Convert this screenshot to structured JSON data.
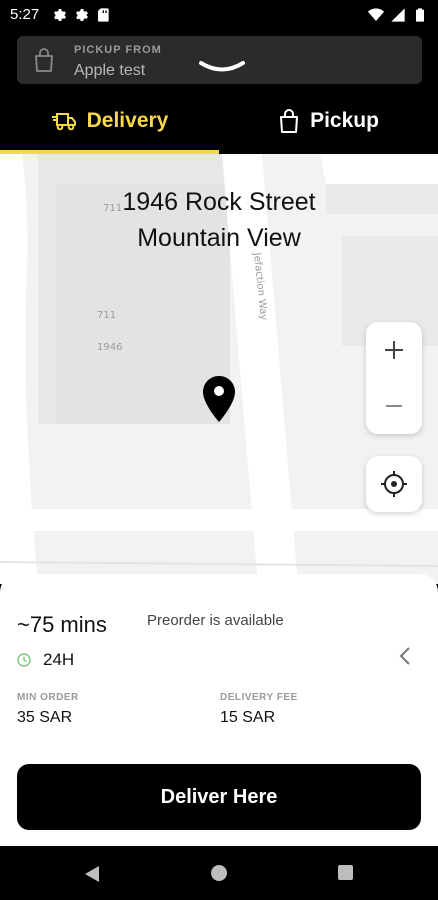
{
  "status_bar": {
    "time": "5:27",
    "icons_left": [
      "gear-icon",
      "gear-icon",
      "sd-card-icon"
    ],
    "icons_right": [
      "wifi-icon",
      "signal-icon",
      "battery-icon"
    ]
  },
  "pickup_card": {
    "label": "PICKUP FROM",
    "store_name": "Apple test"
  },
  "tabs": [
    {
      "label": "Delivery",
      "active": true,
      "icon": "delivery-truck-icon"
    },
    {
      "label": "Pickup",
      "active": false,
      "icon": "shopping-bag-icon"
    }
  ],
  "map": {
    "address_line1": "1946 Rock Street",
    "address_line2": "Mountain View",
    "street_label": "Jefaction Way",
    "building_numbers": [
      "711",
      "711",
      "1946"
    ]
  },
  "info": {
    "eta": "~75 mins",
    "preorder": "Preorder is available",
    "hours": "24H",
    "min_order_label": "MIN ORDER",
    "min_order_value": "35 SAR",
    "delivery_fee_label": "DELIVERY FEE",
    "delivery_fee_value": "15 SAR"
  },
  "deliver_button": "Deliver Here",
  "colors": {
    "accent": "#f5d94b",
    "hours_icon": "#7cc47a"
  }
}
